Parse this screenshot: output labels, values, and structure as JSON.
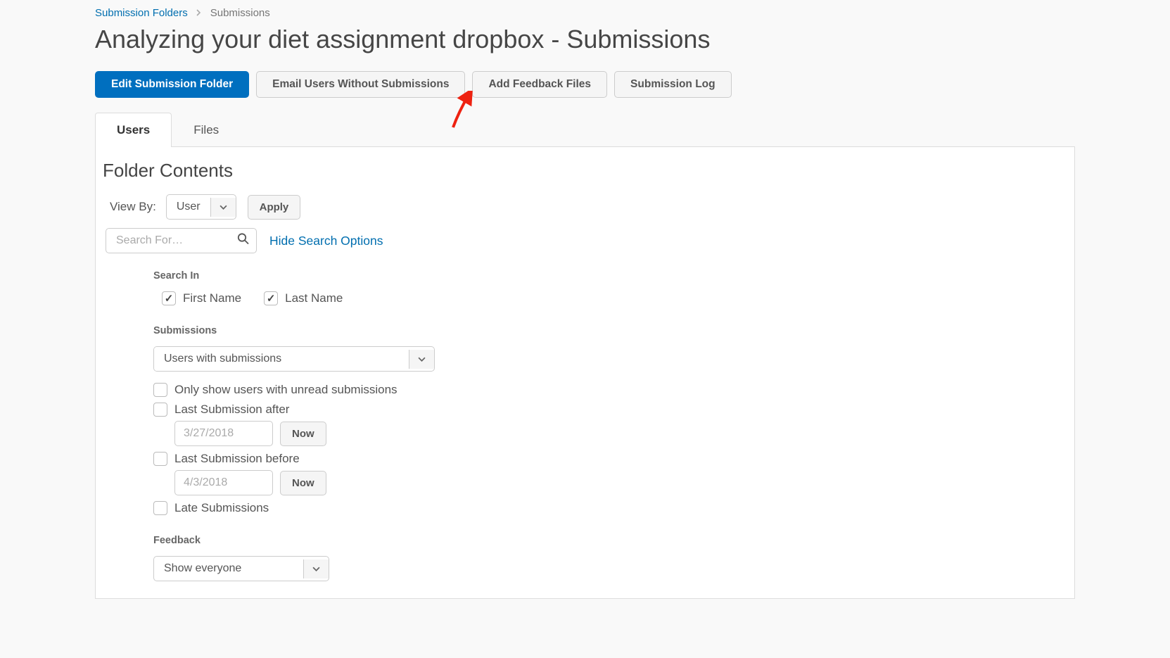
{
  "breadcrumb": {
    "parent": "Submission Folders",
    "current": "Submissions"
  },
  "page_title": "Analyzing your diet assignment dropbox - Submissions",
  "actions": {
    "edit": "Edit Submission Folder",
    "email": "Email Users Without Submissions",
    "feedback": "Add Feedback Files",
    "log": "Submission Log"
  },
  "tabs": {
    "users": "Users",
    "files": "Files"
  },
  "section_title": "Folder Contents",
  "viewby": {
    "label": "View By:",
    "selected": "User",
    "apply": "Apply"
  },
  "search": {
    "placeholder": "Search For…",
    "hide_link": "Hide Search Options"
  },
  "search_in": {
    "heading": "Search In",
    "first_name": "First Name",
    "last_name": "Last Name"
  },
  "submissions": {
    "heading": "Submissions",
    "filter_selected": "Users with submissions",
    "unread": "Only show users with unread submissions",
    "after_label": "Last Submission after",
    "after_placeholder": "3/27/2018",
    "before_label": "Last Submission before",
    "before_placeholder": "4/3/2018",
    "now": "Now",
    "late": "Late Submissions"
  },
  "feedback": {
    "heading": "Feedback",
    "selected": "Show everyone"
  }
}
